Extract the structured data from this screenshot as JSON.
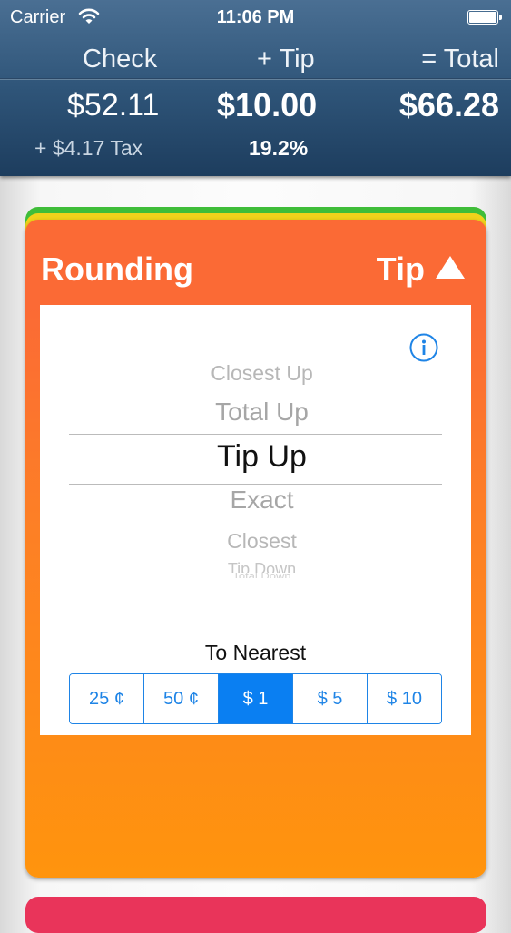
{
  "status_bar": {
    "carrier": "Carrier",
    "time": "11:06 PM"
  },
  "summary": {
    "check_label": "Check",
    "tip_label": "+ Tip",
    "total_label": "= Total",
    "check_amount": "$52.11",
    "tip_amount": "$10.00",
    "total_amount": "$66.28",
    "tax": "+ $4.17 Tax",
    "tip_percent": "19.2%"
  },
  "card": {
    "title": "Rounding",
    "toggle_label": "Tip",
    "background_colors": [
      "#fb6a35",
      "#ff940d"
    ]
  },
  "picker": {
    "options": [
      "Closest Up",
      "Total Up",
      "Tip Up",
      "Exact",
      "Closest",
      "Tip Down",
      "Total Down"
    ],
    "selected": "Tip Up"
  },
  "nearest": {
    "label": "To Nearest",
    "options": [
      "25 ¢",
      "50 ¢",
      "$ 1",
      "$ 5",
      "$ 10"
    ],
    "selected": "$ 1"
  },
  "colors": {
    "accent": "#0a7ff2",
    "header": "#2f5579",
    "stack_green": "#3fbd39",
    "stack_yellow": "#f0d21b",
    "next_card": "#e9345a"
  }
}
